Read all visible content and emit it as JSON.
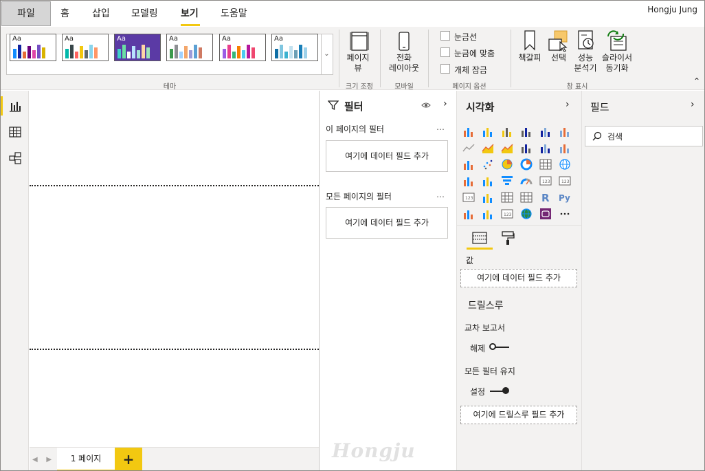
{
  "menu": {
    "file": "파일",
    "tabs": [
      "홈",
      "삽입",
      "모델링",
      "보기",
      "도움말"
    ],
    "active_tab": "보기",
    "user": "Hongju Jung"
  },
  "ribbon": {
    "theme_group_label": "테마",
    "themes": [
      {
        "label": "Aa",
        "bg": "#ffffff",
        "colors": [
          "#118dff",
          "#12239e",
          "#e66c37",
          "#6b007b",
          "#e044a7",
          "#744ec2",
          "#d9b300"
        ]
      },
      {
        "label": "Aa",
        "bg": "#ffffff",
        "colors": [
          "#01b8aa",
          "#374649",
          "#fd625e",
          "#f2c80f",
          "#5f6b6d",
          "#8ad4eb",
          "#fe9666"
        ]
      },
      {
        "label": "Aa",
        "bg": "#5b3aa5",
        "colors": [
          "#3fd0c9",
          "#6bdfa4",
          "#ffffff",
          "#b8e2ff",
          "#a3e4d7",
          "#ffd6a5",
          "#9ee6b8"
        ]
      },
      {
        "label": "Aa",
        "bg": "#ffffff",
        "colors": [
          "#3c9b4d",
          "#8d8f92",
          "#a0d1ff",
          "#f3a66b",
          "#9c9bd9",
          "#5ca0d3",
          "#cf7a63"
        ]
      },
      {
        "label": "Aa",
        "bg": "#ffffff",
        "colors": [
          "#9b5de5",
          "#e83e8c",
          "#35b779",
          "#f77f00",
          "#4cc9f0",
          "#b5179e",
          "#ef476f"
        ]
      },
      {
        "label": "Aa",
        "bg": "#ffffff",
        "colors": [
          "#0f6ea5",
          "#7fc6e0",
          "#3bb2d0",
          "#c2e1ef",
          "#6c9fb5",
          "#1a7fb8",
          "#9dd1ea"
        ]
      }
    ],
    "page_view": "페이지\n뷰",
    "size_group_label": "크기 조정",
    "mobile_layout": "전화\n레이아웃",
    "mobile_group_label": "모바일",
    "page_options": [
      "눈금선",
      "눈금에 맞춤",
      "개체 잠금"
    ],
    "page_options_group_label": "페이지 옵션",
    "show_panes": [
      {
        "label": "책갈피",
        "icon": "bookmark-icon"
      },
      {
        "label": "선택",
        "icon": "selection-icon"
      },
      {
        "label": "성능\n분석기",
        "icon": "performance-analyzer-icon"
      },
      {
        "label": "슬라이서\n동기화",
        "icon": "sync-slicers-icon"
      }
    ],
    "show_panes_group_label": "창 표시"
  },
  "filters": {
    "title": "필터",
    "page_section": "이 페이지의 필터",
    "all_section": "모든 페이지의 필터",
    "drop_text": "여기에 데이터 필드 추가"
  },
  "viz": {
    "title": "시각화",
    "values_label": "값",
    "values_drop": "여기에 데이터 필드 추가",
    "drillthrough_title": "드릴스루",
    "cross_report": "교차 보고서",
    "cross_report_state": "해제",
    "keep_filters": "모든 필터 유지",
    "keep_filters_state": "설정",
    "drillthrough_drop": "여기에 드릴스루 필드 추가"
  },
  "fields": {
    "title": "필드",
    "search_placeholder": "검색"
  },
  "pages": {
    "tab": "1 페이지",
    "add": "+"
  },
  "watermark": "Hongju"
}
